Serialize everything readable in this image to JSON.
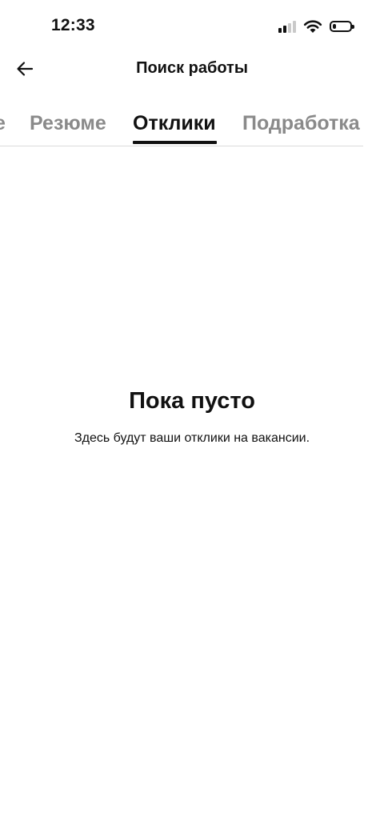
{
  "status_bar": {
    "time": "12:33",
    "icons": [
      "cellular-signal-icon",
      "wifi-icon",
      "battery-icon"
    ],
    "signal_bars_active": 2,
    "signal_bars_total": 4,
    "battery_level": 0.2
  },
  "header": {
    "back_icon": "arrow-left-icon",
    "title": "Поиск работы"
  },
  "tabs": {
    "items": [
      {
        "label": "е",
        "active": false
      },
      {
        "label": "Резюме",
        "active": false
      },
      {
        "label": "Отклики",
        "active": true
      },
      {
        "label": "Подработка",
        "active": false
      }
    ]
  },
  "empty_state": {
    "title": "Пока пусто",
    "text": "Здесь будут ваши отклики на вакансии."
  },
  "colors": {
    "text_primary": "#111111",
    "text_inactive_tab": "#8a8a8a",
    "divider": "#dcdcdc",
    "background": "#ffffff"
  }
}
